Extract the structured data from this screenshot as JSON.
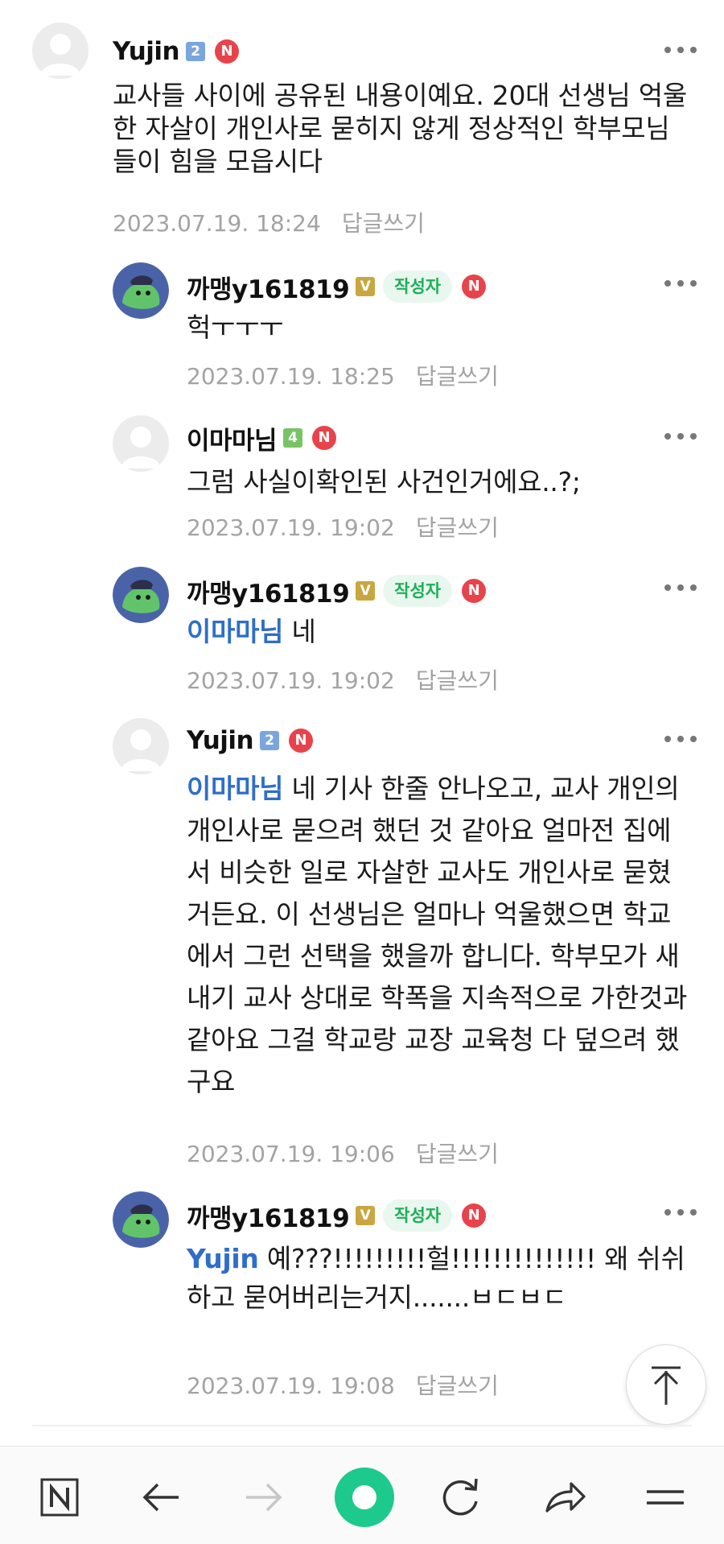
{
  "comments": [
    {
      "nickname": "Yujin",
      "level": "2",
      "new_badge": "N",
      "text": "교사들 사이에 공유된 내용이예요. 20대 선생님 억울한 자살이 개인사로 묻히지 않게 정상적인 학부모님들이 힘을 모읍시다",
      "date": "2023.07.19. 18:24",
      "reply_label": "답글쓰기"
    },
    {
      "nickname": "까맹y161819",
      "level": "V",
      "author_badge": "작성자",
      "new_badge": "N",
      "text": "헉ㅜㅜㅜ",
      "date": "2023.07.19. 18:25",
      "reply_label": "답글쓰기"
    },
    {
      "nickname": "이마마님",
      "level": "4",
      "new_badge": "N",
      "text": "그럼 사실이확인된 사건인거에요..?;",
      "date": "2023.07.19. 19:02",
      "reply_label": "답글쓰기"
    },
    {
      "nickname": "까맹y161819",
      "level": "V",
      "author_badge": "작성자",
      "new_badge": "N",
      "mention": "이마마님",
      "text": "네",
      "date": "2023.07.19. 19:02",
      "reply_label": "답글쓰기"
    },
    {
      "nickname": "Yujin",
      "level": "2",
      "new_badge": "N",
      "mention": "이마마님",
      "text": "네 기사 한줄 안나오고, 교사 개인의 개인사로 묻으려 했던 것 같아요 얼마전 집에서 비슷한 일로 자살한 교사도 개인사로 묻혔거든요. 이 선생님은 얼마나 억울했으면 학교에서 그런 선택을 했을까 합니다. 학부모가 새내기 교사 상대로 학폭을 지속적으로 가한것과 같아요 그걸 학교랑 교장 교육청 다 덮으려 했구요",
      "date": "2023.07.19. 19:06",
      "reply_label": "답글쓰기"
    },
    {
      "nickname": "까맹y161819",
      "level": "V",
      "author_badge": "작성자",
      "new_badge": "N",
      "mention": "Yujin",
      "text": "예???!!!!!!!!!헐!!!!!!!!!!!!!! 왜 쉬쉬하고 묻어버리는거지.......ㅂㄷㅂㄷ",
      "date": "2023.07.19. 19:08",
      "reply_label": "답글쓰기"
    }
  ],
  "navbar": {
    "icons": [
      "naver-home-icon",
      "back-arrow-icon",
      "forward-arrow-icon",
      "green-dot-home-icon",
      "refresh-icon",
      "share-icon",
      "menu-icon"
    ]
  },
  "colors": {
    "mention": "#2f6ec9",
    "author_badge_bg": "#e9f8ee",
    "author_badge_text": "#1fae58",
    "new_badge": "#e8434b",
    "meta_text": "#a3a3a3",
    "nav_green": "#1ec98e"
  }
}
